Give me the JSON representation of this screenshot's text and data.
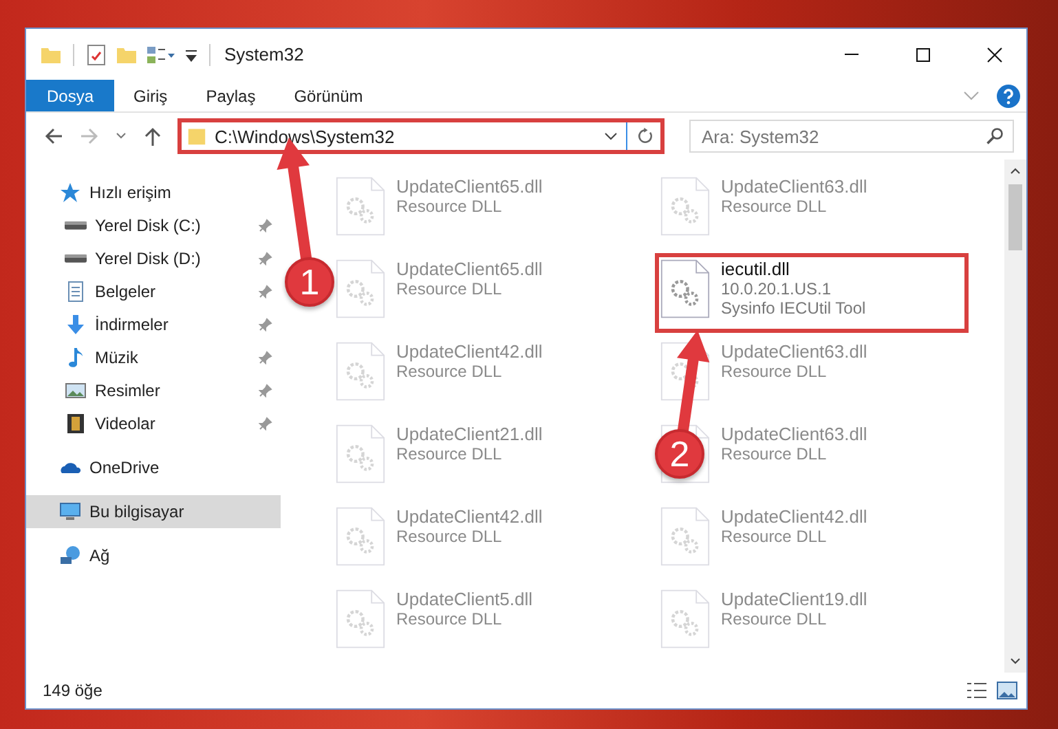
{
  "window": {
    "title": "System32"
  },
  "ribbon_tabs": [
    {
      "label": "Dosya",
      "selected": true
    },
    {
      "label": "Giriş",
      "selected": false
    },
    {
      "label": "Paylaş",
      "selected": false
    },
    {
      "label": "Görünüm",
      "selected": false
    }
  ],
  "address_bar": {
    "value": "C:\\Windows\\System32",
    "highlighted": true
  },
  "search": {
    "placeholder": "Ara: System32"
  },
  "sidebar": {
    "items": [
      {
        "label": "Hızlı erişim",
        "kind": "star",
        "selected": false,
        "children": [
          {
            "label": "Yerel Disk (C:)",
            "kind": "drive",
            "pinned": true
          },
          {
            "label": "Yerel Disk (D:)",
            "kind": "drive",
            "pinned": true
          },
          {
            "label": "Belgeler",
            "kind": "documents",
            "pinned": true
          },
          {
            "label": "İndirmeler",
            "kind": "downloads",
            "pinned": true
          },
          {
            "label": "Müzik",
            "kind": "music",
            "pinned": true
          },
          {
            "label": "Resimler",
            "kind": "pictures",
            "pinned": true
          },
          {
            "label": "Videolar",
            "kind": "videos",
            "pinned": true
          }
        ]
      },
      {
        "label": "OneDrive",
        "kind": "cloud",
        "selected": false
      },
      {
        "label": "Bu bilgisayar",
        "kind": "computer",
        "selected": true
      },
      {
        "label": "Ağ",
        "kind": "network",
        "selected": false
      }
    ]
  },
  "files": [
    {
      "name": "UpdateClient65.dll",
      "lines": [
        "Resource DLL"
      ],
      "faded": true,
      "highlighted": false
    },
    {
      "name": "UpdateClient63.dll",
      "lines": [
        "Resource DLL"
      ],
      "faded": true,
      "highlighted": false
    },
    {
      "name": "UpdateClient65.dll",
      "lines": [
        "Resource DLL"
      ],
      "faded": true,
      "highlighted": false
    },
    {
      "name": "iecutil.dll",
      "lines": [
        "10.0.20.1.US.1",
        "Sysinfo IECUtil Tool"
      ],
      "faded": false,
      "highlighted": true
    },
    {
      "name": "UpdateClient42.dll",
      "lines": [
        "Resource DLL"
      ],
      "faded": true,
      "highlighted": false
    },
    {
      "name": "UpdateClient63.dll",
      "lines": [
        "Resource DLL"
      ],
      "faded": true,
      "highlighted": false
    },
    {
      "name": "UpdateClient21.dll",
      "lines": [
        "Resource DLL"
      ],
      "faded": true,
      "highlighted": false
    },
    {
      "name": "UpdateClient63.dll",
      "lines": [
        "Resource DLL"
      ],
      "faded": true,
      "highlighted": false
    },
    {
      "name": "UpdateClient42.dll",
      "lines": [
        "Resource DLL"
      ],
      "faded": true,
      "highlighted": false
    },
    {
      "name": "UpdateClient42.dll",
      "lines": [
        "Resource DLL"
      ],
      "faded": true,
      "highlighted": false
    },
    {
      "name": "UpdateClient5.dll",
      "lines": [
        "Resource DLL"
      ],
      "faded": true,
      "highlighted": false
    },
    {
      "name": "UpdateClient19.dll",
      "lines": [
        "Resource DLL"
      ],
      "faded": true,
      "highlighted": false
    }
  ],
  "status_bar": {
    "item_count": "149 öğe"
  },
  "annotations": [
    {
      "label": "1"
    },
    {
      "label": "2"
    }
  ]
}
